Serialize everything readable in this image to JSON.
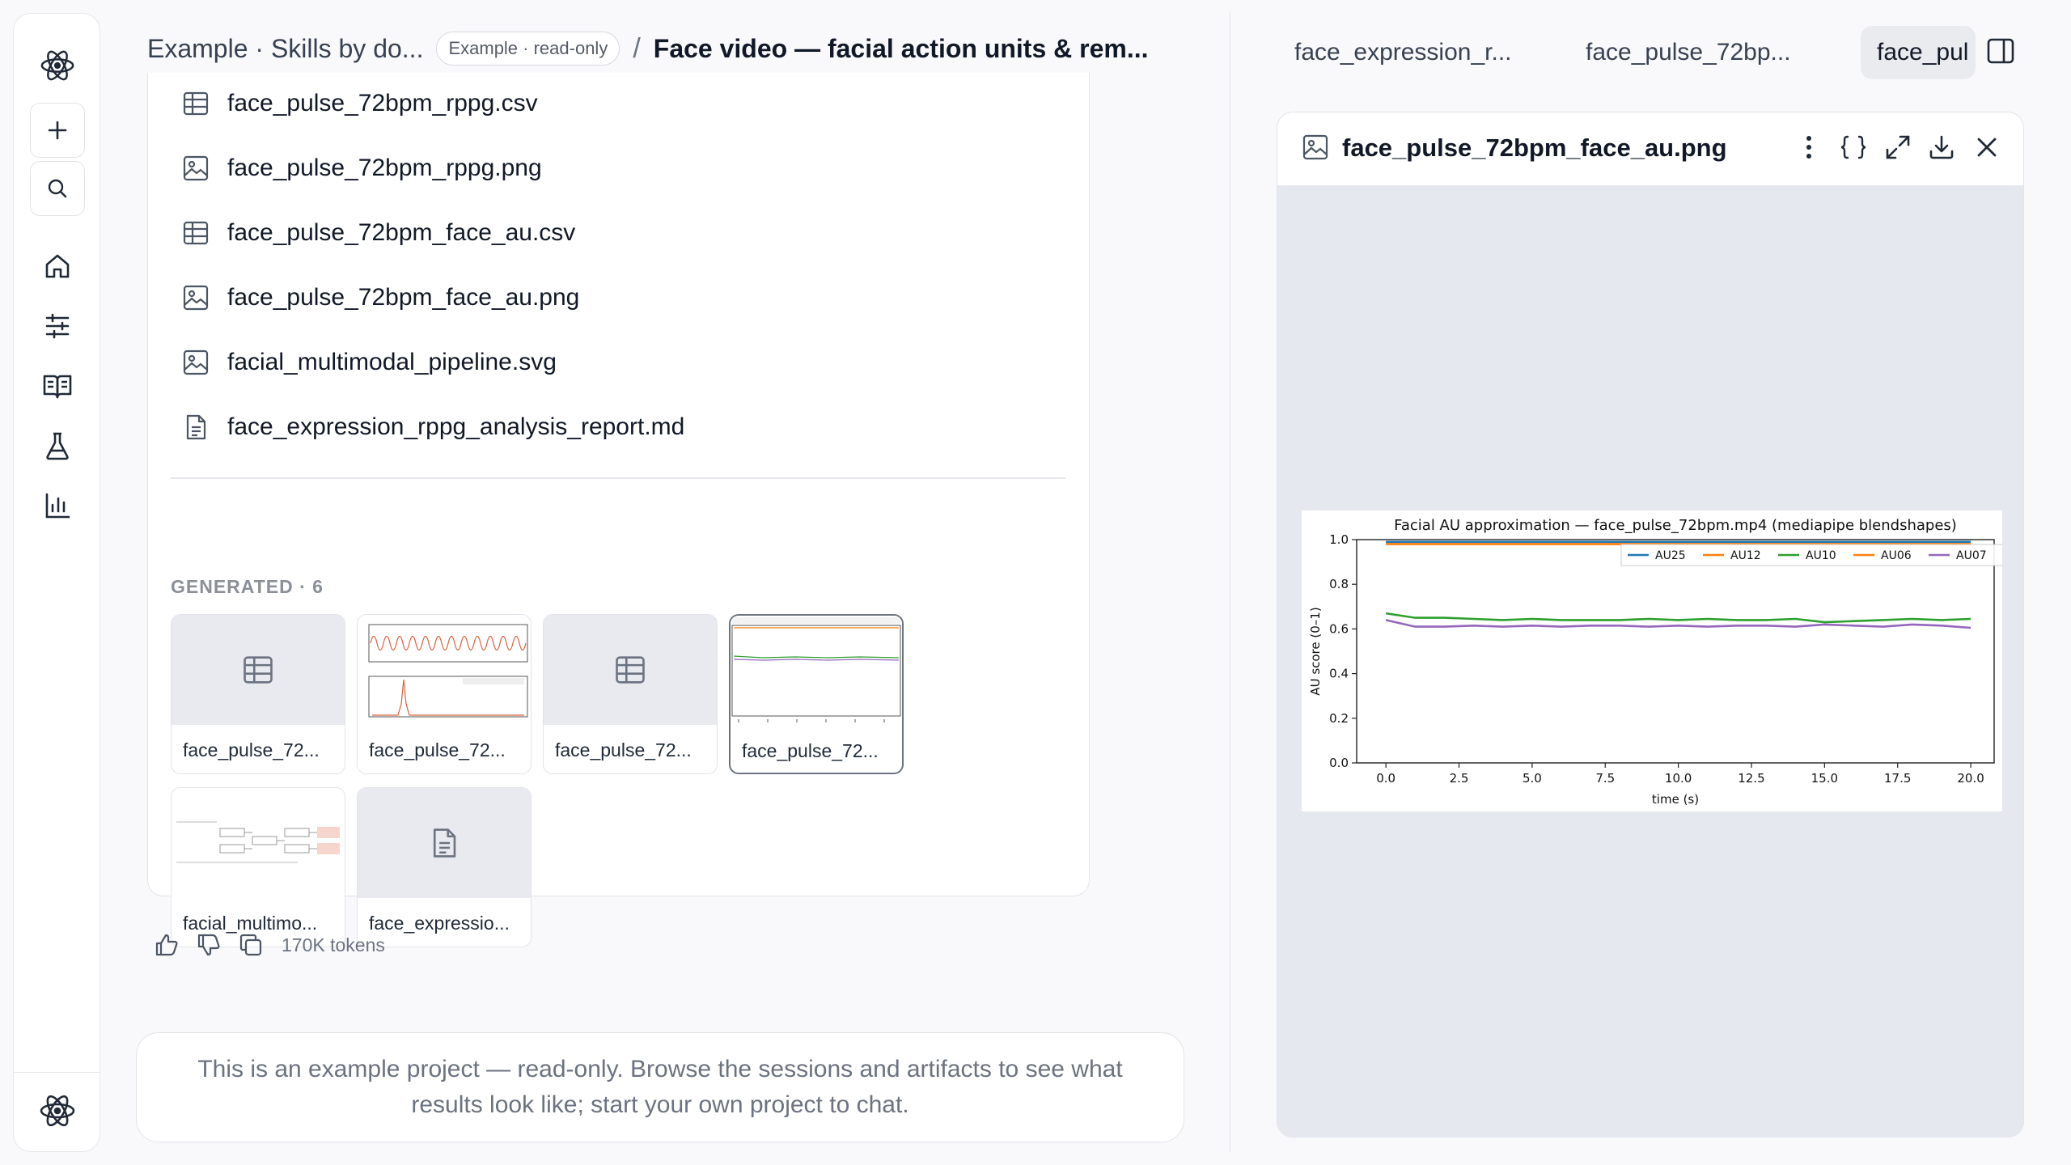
{
  "breadcrumb": {
    "workspace": "Example · Skills by do...",
    "badge": "Example · read-only",
    "separator": "/",
    "title": "Face video — facial action units & rem..."
  },
  "files": [
    {
      "name": "face_pulse_72bpm_rppg.csv",
      "icon": "table-icon"
    },
    {
      "name": "face_pulse_72bpm_rppg.png",
      "icon": "image-icon"
    },
    {
      "name": "face_pulse_72bpm_face_au.csv",
      "icon": "table-icon"
    },
    {
      "name": "face_pulse_72bpm_face_au.png",
      "icon": "image-icon"
    },
    {
      "name": "facial_multimodal_pipeline.svg",
      "icon": "image-icon"
    },
    {
      "name": "face_expression_rppg_analysis_report.md",
      "icon": "document-icon"
    }
  ],
  "generated": {
    "label": "GENERATED · 6",
    "items": [
      {
        "name": "face_pulse_72...",
        "kind": "table-icon"
      },
      {
        "name": "face_pulse_72...",
        "kind": "rppg-preview"
      },
      {
        "name": "face_pulse_72...",
        "kind": "table-icon"
      },
      {
        "name": "face_pulse_72...",
        "kind": "au-preview",
        "selected": true
      },
      {
        "name": "facial_multimo...",
        "kind": "pipeline-preview"
      },
      {
        "name": "face_expressio...",
        "kind": "document-icon"
      }
    ]
  },
  "message_actions": {
    "tokens": "170K tokens"
  },
  "notice": "This is an example project — read-only. Browse the sessions and artifacts to see what results look like; start your own project to chat.",
  "tabs": [
    {
      "label": "face_expression_r..."
    },
    {
      "label": "face_pulse_72bp..."
    },
    {
      "label": "face_pul",
      "active": true
    }
  ],
  "viewer": {
    "title": "face_pulse_72bpm_face_au.png"
  },
  "chart_data": {
    "type": "line",
    "title": "Facial AU approximation — face_pulse_72bpm.mp4 (mediapipe blendshapes)",
    "xlabel": "time (s)",
    "ylabel": "AU score (0–1)",
    "xlim": [
      -1,
      20.8
    ],
    "ylim": [
      0,
      1.0
    ],
    "xticks": [
      0.0,
      2.5,
      5.0,
      7.5,
      10.0,
      12.5,
      15.0,
      17.5,
      20.0
    ],
    "xtick_labels": [
      "0.0",
      "2.5",
      "5.0",
      "7.5",
      "10.0",
      "12.5",
      "15.0",
      "17.5",
      "20.0"
    ],
    "yticks": [
      0.0,
      0.2,
      0.4,
      0.6,
      0.8,
      1.0
    ],
    "ytick_labels": [
      "0.0",
      "0.2",
      "0.4",
      "0.6",
      "0.8",
      "1.0"
    ],
    "legend_position": "top-right",
    "grid": false,
    "x": [
      0,
      1,
      2,
      3,
      4,
      5,
      6,
      7,
      8,
      9,
      10,
      11,
      12,
      13,
      14,
      15,
      16,
      17,
      18,
      19,
      20
    ],
    "series": [
      {
        "name": "AU25",
        "color": "#1f77b4",
        "values": [
          0.99,
          0.99,
          0.99,
          0.99,
          0.99,
          0.99,
          0.99,
          0.99,
          0.99,
          0.99,
          0.99,
          0.99,
          0.99,
          0.99,
          0.99,
          0.99,
          0.99,
          0.99,
          0.99,
          0.99,
          0.99
        ]
      },
      {
        "name": "AU12",
        "color": "#ff7f0e",
        "values": [
          0.98,
          0.98,
          0.98,
          0.98,
          0.98,
          0.98,
          0.98,
          0.98,
          0.98,
          0.98,
          0.98,
          0.98,
          0.98,
          0.98,
          0.98,
          0.98,
          0.98,
          0.98,
          0.98,
          0.98,
          0.98
        ]
      },
      {
        "name": "AU10",
        "color": "#2ca02c",
        "values": [
          0.67,
          0.65,
          0.65,
          0.645,
          0.64,
          0.645,
          0.64,
          0.64,
          0.64,
          0.645,
          0.64,
          0.645,
          0.64,
          0.64,
          0.645,
          0.63,
          0.635,
          0.64,
          0.645,
          0.64,
          0.645
        ]
      },
      {
        "name": "AU06",
        "color": "#ff7f0e",
        "values": [
          0.98,
          0.98,
          0.98,
          0.98,
          0.98,
          0.98,
          0.98,
          0.98,
          0.98,
          0.98,
          0.98,
          0.98,
          0.98,
          0.98,
          0.98,
          0.98,
          0.98,
          0.98,
          0.98,
          0.98,
          0.98
        ]
      },
      {
        "name": "AU07",
        "color": "#9467bd",
        "values": [
          0.64,
          0.61,
          0.61,
          0.615,
          0.61,
          0.615,
          0.61,
          0.615,
          0.615,
          0.61,
          0.615,
          0.61,
          0.615,
          0.615,
          0.61,
          0.62,
          0.615,
          0.61,
          0.62,
          0.615,
          0.605
        ]
      }
    ]
  }
}
